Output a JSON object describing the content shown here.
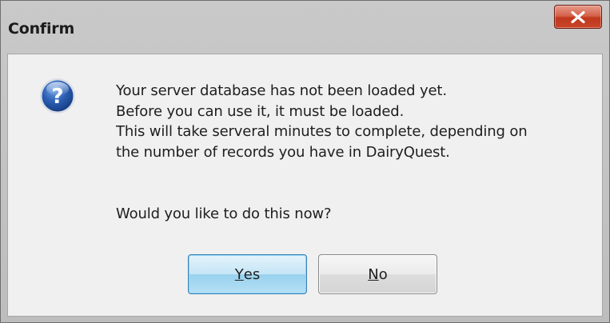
{
  "window": {
    "title": "Confirm",
    "close_icon": "close-icon"
  },
  "icon": {
    "name": "question-icon",
    "glyph": "?"
  },
  "message": {
    "lines": [
      "Your server database has not been loaded yet.",
      "Before you can use it, it must be loaded.",
      "This will take serveral minutes to complete, depending on",
      "the number of records you have in DairyQuest."
    ],
    "question": "Would you like to do this now?"
  },
  "buttons": {
    "yes": {
      "accel": "Y",
      "rest": "es",
      "is_default": true
    },
    "no": {
      "accel": "N",
      "rest": "o",
      "is_default": false
    }
  },
  "colors": {
    "default_button_border": "#3c7fb1",
    "close_button": "#c9452a",
    "question_icon": "#2456a8"
  }
}
